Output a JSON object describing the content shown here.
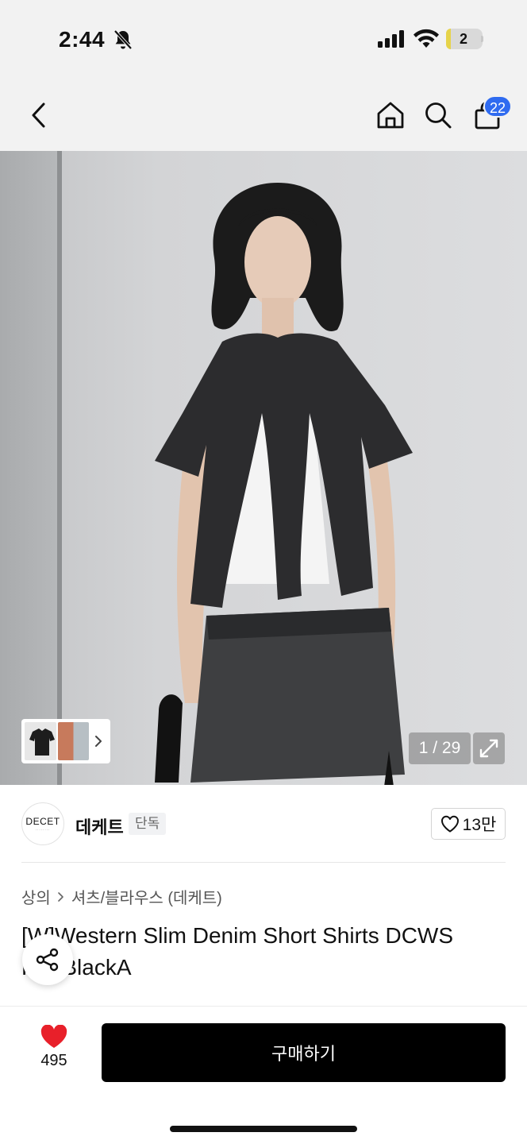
{
  "status_bar": {
    "time": "2:44",
    "battery_level": "2",
    "battery_fraction": 0.12,
    "icons": [
      "bell-off-icon",
      "cellular-signal-icon",
      "wifi-icon",
      "battery-icon"
    ]
  },
  "nav": {
    "icons": [
      "chevron-left-icon",
      "home-icon",
      "search-icon",
      "shopping-bag-icon"
    ],
    "cart_count": "22"
  },
  "gallery": {
    "page_indicator": "1 / 29",
    "icons": [
      "chevron-right-icon",
      "expand-icon"
    ]
  },
  "brand": {
    "logo_text": "DECET",
    "name": "데케트",
    "badge": "단독",
    "like_count": "13만"
  },
  "product": {
    "breadcrumb": [
      "상의",
      "셔츠/블라우스 (데케트)"
    ],
    "title": "[W]Western Slim Denim Short Shirts DCWS R02BlackA"
  },
  "bottom_bar": {
    "wish_count": "495",
    "buy_label": "구매하기"
  },
  "colors": {
    "accent_blue": "#2f6bf0",
    "heart_red": "#e8202a",
    "buy_button": "#000000"
  }
}
